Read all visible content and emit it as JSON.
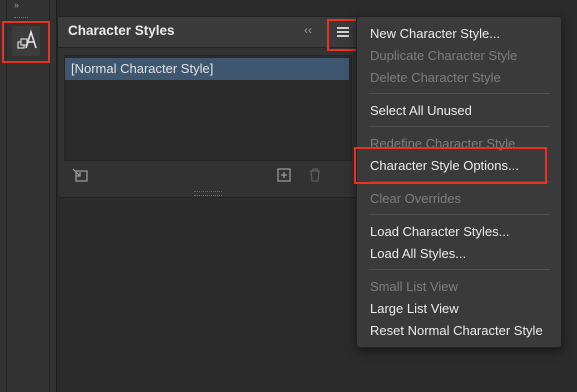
{
  "dock": {
    "collapse_glyph": "››",
    "character_styles_icon": "character-styles-icon"
  },
  "panel": {
    "title": "Character Styles",
    "collapse_glyph": "‹‹",
    "menu_icon": "hamburger-menu-icon",
    "list_items": [
      "[Normal Character Style]"
    ],
    "footer_icons": [
      "load-styles-icon",
      "new-style-icon",
      "trash-icon"
    ]
  },
  "menu": {
    "items": [
      {
        "label": "New Character Style...",
        "enabled": true
      },
      {
        "label": "Duplicate Character Style",
        "enabled": false
      },
      {
        "label": "Delete Character Style",
        "enabled": false
      },
      {
        "label": "Select All Unused",
        "enabled": true
      },
      {
        "label": "Redefine Character Style",
        "enabled": false
      },
      {
        "label": "Character Style Options...",
        "enabled": true
      },
      {
        "label": "Clear Overrides",
        "enabled": false
      },
      {
        "label": "Load Character Styles...",
        "enabled": true
      },
      {
        "label": "Load All Styles...",
        "enabled": true
      },
      {
        "label": "Small List View",
        "enabled": false
      },
      {
        "label": "Large List View",
        "enabled": true
      },
      {
        "label": "Reset Normal Character Style",
        "enabled": true
      }
    ]
  },
  "colors": {
    "highlight": "#e8321e",
    "selection": "#3e5670"
  }
}
